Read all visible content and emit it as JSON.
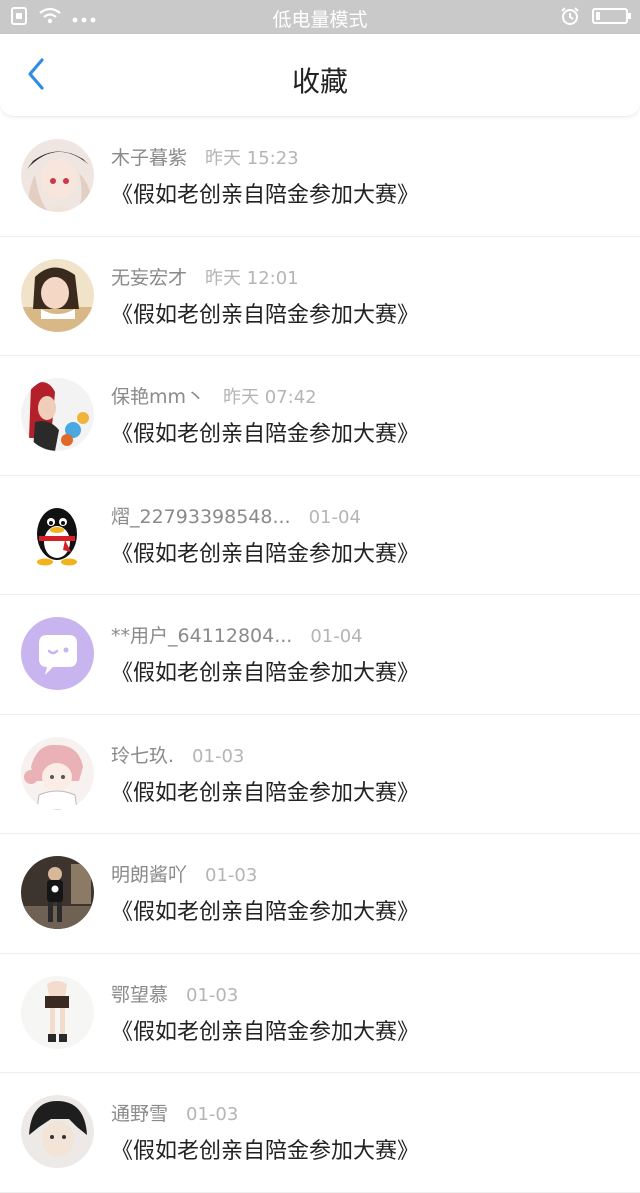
{
  "status_bar": {
    "center_text": "低电量模式"
  },
  "header": {
    "title": "收藏"
  },
  "items": [
    {
      "user": "木子暮紫",
      "time": "昨天 15:23",
      "title": "《假如老创亲自陪金参加大赛》"
    },
    {
      "user": "无妄宏才",
      "time": "昨天 12:01",
      "title": "《假如老创亲自陪金参加大赛》"
    },
    {
      "user": "保艳mm丶",
      "time": "昨天 07:42",
      "title": "《假如老创亲自陪金参加大赛》"
    },
    {
      "user": "熠_22793398548...",
      "time": "01-04",
      "title": "《假如老创亲自陪金参加大赛》"
    },
    {
      "user": "**用户_64112804...",
      "time": "01-04",
      "title": "《假如老创亲自陪金参加大赛》"
    },
    {
      "user": "玲七玖.",
      "time": "01-03",
      "title": "《假如老创亲自陪金参加大赛》"
    },
    {
      "user": "明朗酱吖",
      "time": "01-03",
      "title": "《假如老创亲自陪金参加大赛》"
    },
    {
      "user": "鄂望慕",
      "time": "01-03",
      "title": "《假如老创亲自陪金参加大赛》"
    },
    {
      "user": "通野雪",
      "time": "01-03",
      "title": "《假如老创亲自陪金参加大赛》"
    }
  ],
  "colors": {
    "accent": "#2f8de4",
    "status_bar_bg": "#c9c9c9",
    "username": "#8a8a8a",
    "time": "#b5b5b5",
    "title": "#222222"
  }
}
